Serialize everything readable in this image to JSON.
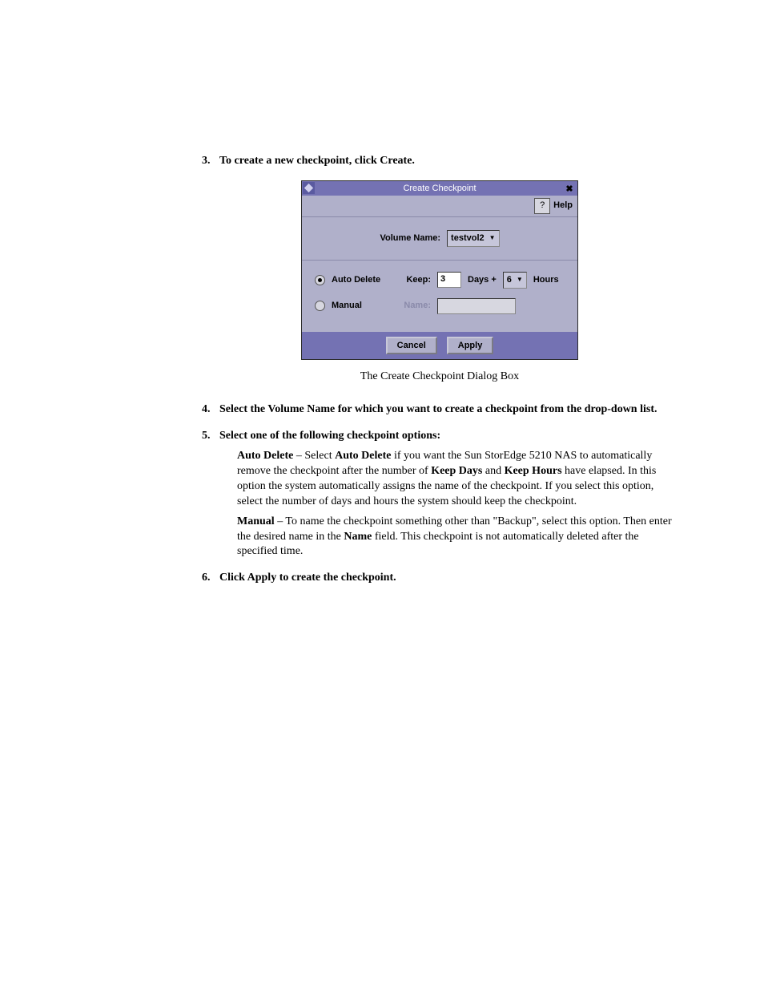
{
  "steps": {
    "s3": {
      "num": "3.",
      "text": "To create a new checkpoint, click Create."
    },
    "s4": {
      "num": "4.",
      "text": "Select the Volume Name for which you want to create a checkpoint from the drop-down list."
    },
    "s5": {
      "num": "5.",
      "text": "Select one of the following checkpoint options:"
    },
    "s6": {
      "num": "6.",
      "text": "Click Apply to create the checkpoint."
    }
  },
  "caption": "The Create Checkpoint Dialog Box",
  "dialog": {
    "title": "Create Checkpoint",
    "close_glyph": "✖",
    "help_label": "Help",
    "help_glyph": "?",
    "volume_label": "Volume Name:",
    "volume_value": "testvol2",
    "auto_delete_label": "Auto Delete",
    "keep_label": "Keep:",
    "days_value": "3",
    "days_label": "Days +",
    "hours_value": "6",
    "hours_label": "Hours",
    "manual_label": "Manual",
    "name_label": "Name:",
    "name_value": "",
    "cancel_label": "Cancel",
    "apply_label": "Apply"
  },
  "body": {
    "auto_bold1": "Auto Delete",
    "auto_t1": " – Select ",
    "auto_bold2": "Auto Delete",
    "auto_t2": " if you want the Sun StorEdge 5210 NAS to automatically remove the checkpoint after the number of ",
    "keep_days": "Keep Days",
    "and": " and ",
    "keep_hours": "Keep Hours",
    "auto_t3": " have elapsed. In this option the system automatically assigns the name of the checkpoint. If you select this option, select the number of days and hours the system should keep the checkpoint.",
    "manual_bold": "Manual",
    "manual_t1": " – To name the checkpoint something other than \"Backup\", select this option. Then enter the desired name in the ",
    "name_bold": "Name",
    "manual_t2": " field. This checkpoint is not automatically deleted after the specified time."
  }
}
